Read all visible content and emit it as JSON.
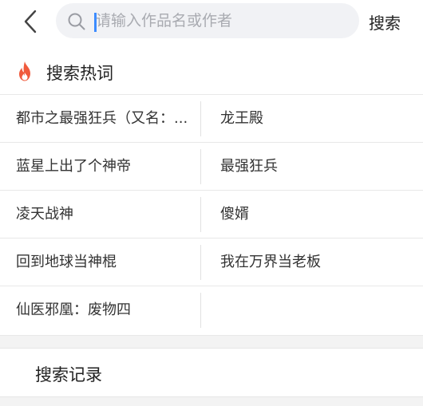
{
  "search": {
    "placeholder": "请输入作品名或作者",
    "value": "",
    "button_label": "搜索"
  },
  "hot": {
    "title": "搜索热词",
    "items": [
      "都市之最强狂兵（又名：...",
      "龙王殿",
      "蓝星上出了个神帝",
      "最强狂兵",
      "凌天战神",
      "傻婿",
      "回到地球当神棍",
      "我在万界当老板",
      "仙医邪凰：废物四",
      ""
    ]
  },
  "history": {
    "title": "搜索记录"
  },
  "colors": {
    "accent": "#3d8cff",
    "fire": "#f05a3c",
    "search_bg": "#f1f2f5"
  },
  "icons": {
    "back": "chevron-left-icon",
    "search": "search-icon",
    "hot": "fire-icon"
  }
}
